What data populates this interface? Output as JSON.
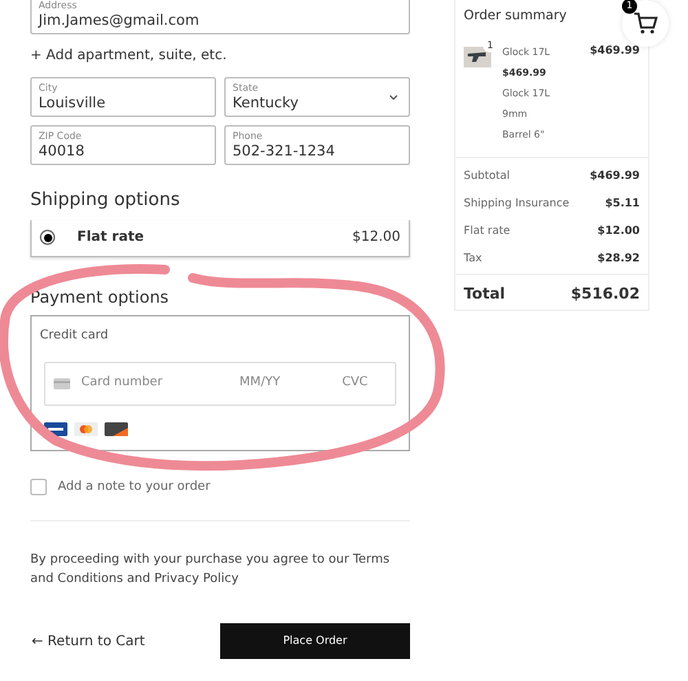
{
  "address_form": {
    "fields": [
      {
        "label": "Address",
        "value": "Jim.James@gmail.com",
        "kind": "text"
      },
      {
        "label": "City",
        "value": "Louisville",
        "kind": "text"
      },
      {
        "label": "State",
        "value": "Kentucky",
        "kind": "select"
      },
      {
        "label": "ZIP Code",
        "value": "40018",
        "kind": "text"
      },
      {
        "label": "Phone",
        "value": "502-321-1234",
        "kind": "text"
      }
    ],
    "add_line_link": "+ Add apartment, suite, etc."
  },
  "shipping": {
    "title": "Shipping options",
    "options": [
      {
        "label": "Flat rate",
        "price": "$12.00",
        "selected": true
      }
    ]
  },
  "payment": {
    "title": "Payment options",
    "method": "Credit card",
    "card_number_placeholder": "Card number",
    "expiry_placeholder": "MM/YY",
    "cvc_placeholder": "CVC"
  },
  "note_checkbox": {
    "label": "Add a note to your order",
    "checked": false
  },
  "terms": "By proceeding with your purchase you agree to our Terms and Conditions and Privacy Policy",
  "return_link": "← Return to Cart",
  "place_order": "Place Order",
  "cart_badge": "1",
  "order_summary": {
    "title": "Order summary",
    "items": [
      {
        "quantity": "1",
        "name": "Glock 17L",
        "price": "$469.99",
        "unit_price": "$469.99",
        "details": [
          "Glock 17L",
          "9mm",
          "Barrel 6\""
        ]
      }
    ],
    "lines": [
      {
        "label": "Subtotal",
        "value": "$469.99"
      },
      {
        "label": "Shipping Insurance",
        "value": "$5.11"
      },
      {
        "label": "Flat rate",
        "value": "$12.00"
      },
      {
        "label": "Tax",
        "value": "$28.92"
      }
    ],
    "total": {
      "label": "Total",
      "value": "$516.02"
    }
  }
}
